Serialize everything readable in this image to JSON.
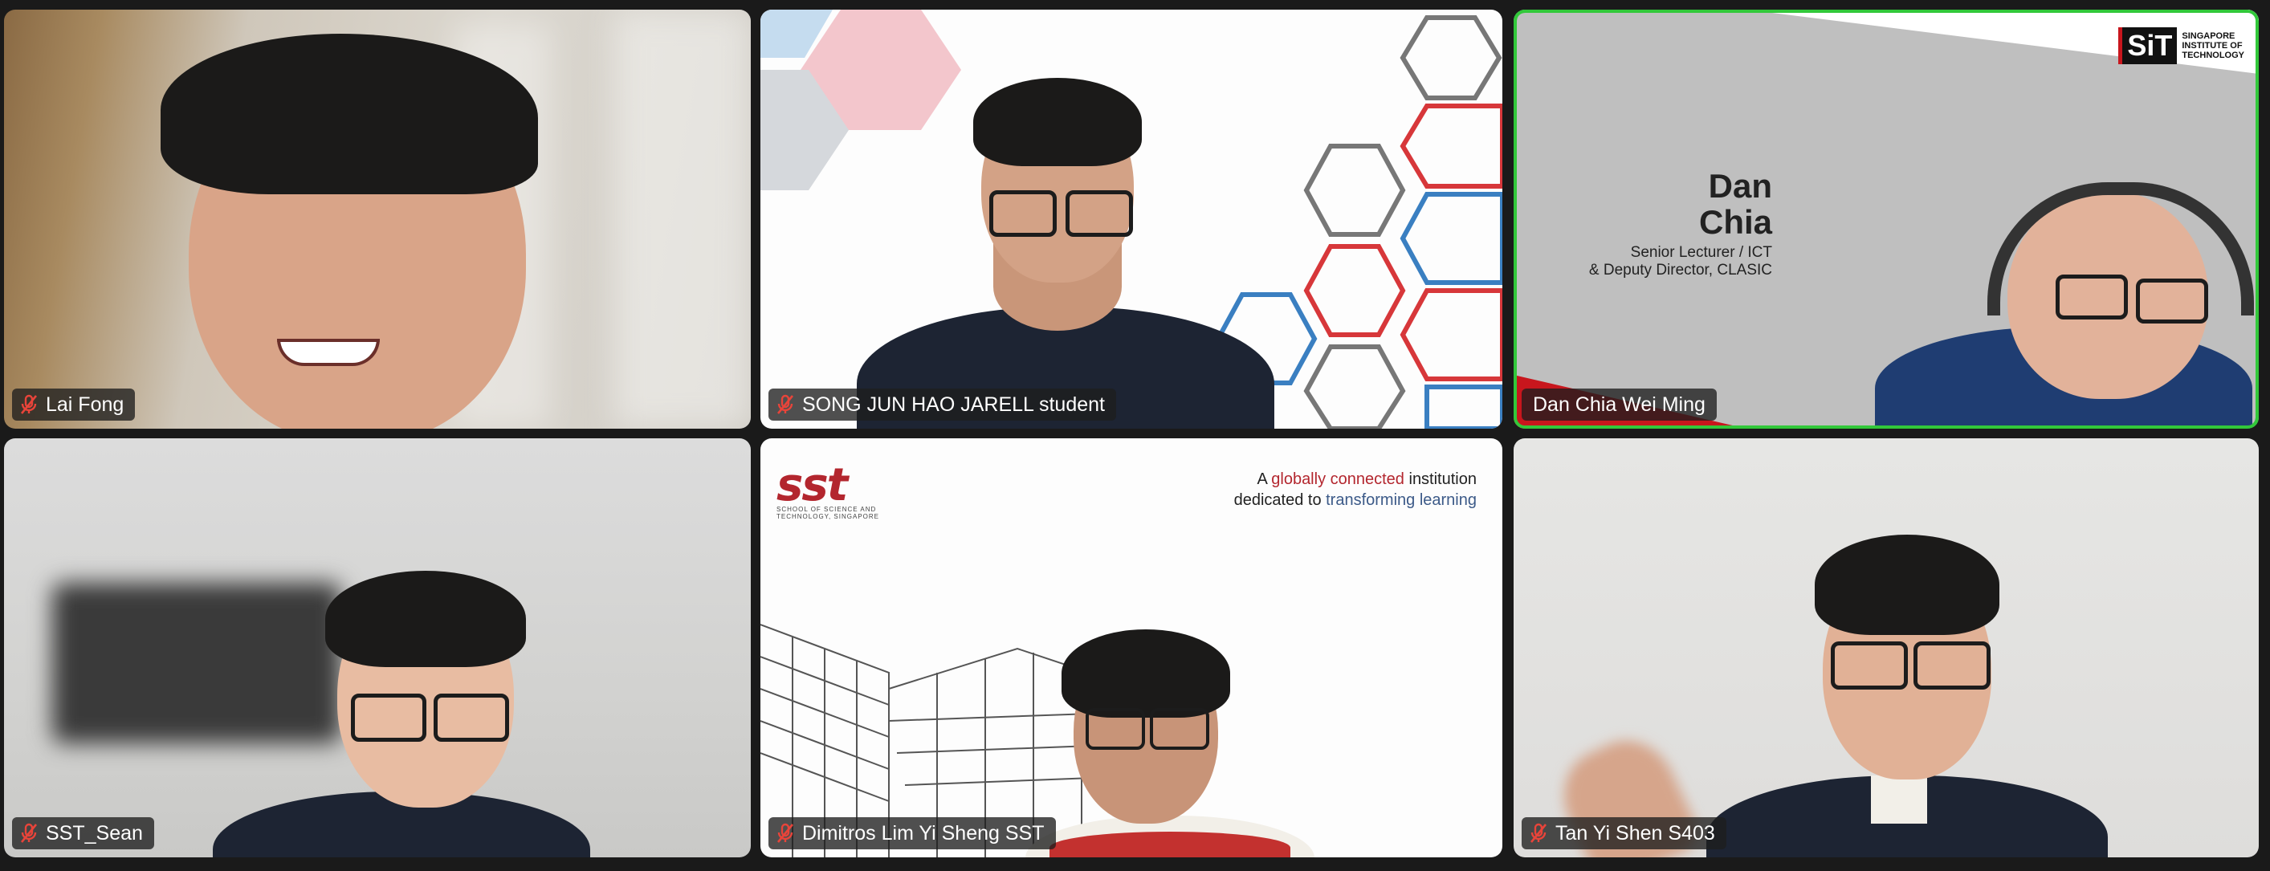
{
  "meeting": {
    "participants": [
      {
        "name": "Lai Fong",
        "muted": true,
        "active_speaker": false
      },
      {
        "name": "SONG JUN HAO JARELL student",
        "muted": true,
        "active_speaker": false
      },
      {
        "name": "Dan Chia Wei Ming",
        "muted": false,
        "active_speaker": true
      },
      {
        "name": "SST_Sean",
        "muted": true,
        "active_speaker": false
      },
      {
        "name": "Dimitros Lim Yi Sheng SST",
        "muted": true,
        "active_speaker": false
      },
      {
        "name": "Tan Yi Shen S403",
        "muted": true,
        "active_speaker": false
      }
    ]
  },
  "backgrounds": {
    "dan_chia": {
      "name_line1": "Dan",
      "name_line2": "Chia",
      "title_line1": "Senior Lecturer / ICT",
      "title_line2": "& Deputy Director, CLASIC",
      "logo_mark": "SiT",
      "logo_text_1": "SINGAPORE",
      "logo_text_2": "INSTITUTE OF",
      "logo_text_3": "TECHNOLOGY"
    },
    "sst": {
      "logo_mark": "sst",
      "logo_sub_1": "SCHOOL OF SCIENCE AND",
      "logo_sub_2": "TECHNOLOGY, SINGAPORE",
      "tagline_a": "A ",
      "tagline_b": "globally connected",
      "tagline_c": " institution",
      "tagline_d": "dedicated to ",
      "tagline_e": "transforming learning"
    }
  },
  "colors": {
    "active_border": "#32c83a",
    "muted_icon": "#e8443a",
    "sit_red": "#c8161d",
    "sst_red": "#b3262e",
    "sst_blue": "#3c5a88"
  }
}
